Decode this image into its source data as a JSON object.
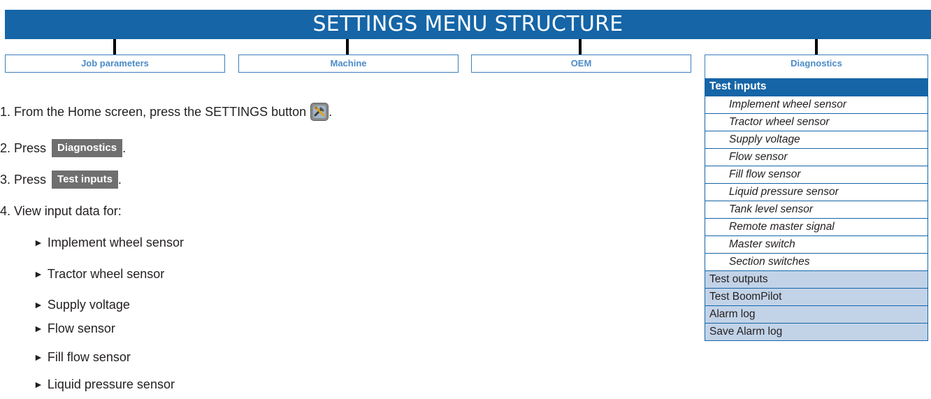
{
  "banner": {
    "title": "SETTINGS MENU STRUCTURE"
  },
  "menu": [
    {
      "label": "Job parameters"
    },
    {
      "label": "Machine"
    },
    {
      "label": "OEM"
    },
    {
      "label": "Diagnostics"
    }
  ],
  "tree": {
    "header": "Test inputs",
    "subitems": [
      "Implement wheel sensor",
      "Tractor wheel sensor",
      "Supply voltage",
      "Flow sensor",
      "Fill flow sensor",
      "Liquid pressure sensor",
      "Tank level sensor",
      "Remote master signal",
      "Master switch",
      "Section switches"
    ],
    "items": [
      "Test outputs",
      "Test BoomPilot",
      "Alarm log",
      "Save Alarm log"
    ]
  },
  "steps": {
    "step1_text": "1. From the Home screen, press the SETTINGS button",
    "step1_end": ".",
    "step1_icon": "settings-tools-icon",
    "step2_text": "2. Press",
    "step2_button": "Diagnostics",
    "step2_end": ".",
    "step3_text": "3. Press",
    "step3_button": "Test inputs",
    "step3_end": ".",
    "step4_text": "4. View input data for:"
  },
  "bullets": [
    "Implement wheel sensor",
    "Tractor wheel sensor",
    "Supply voltage",
    "Flow sensor",
    "Fill flow sensor",
    "Liquid pressure sensor"
  ],
  "colors": {
    "banner": "#1565a7",
    "menu_text": "#4a8bc8",
    "tree_item_bg": "#c2d3e8",
    "inline_button_bg": "#6f6f6f"
  }
}
